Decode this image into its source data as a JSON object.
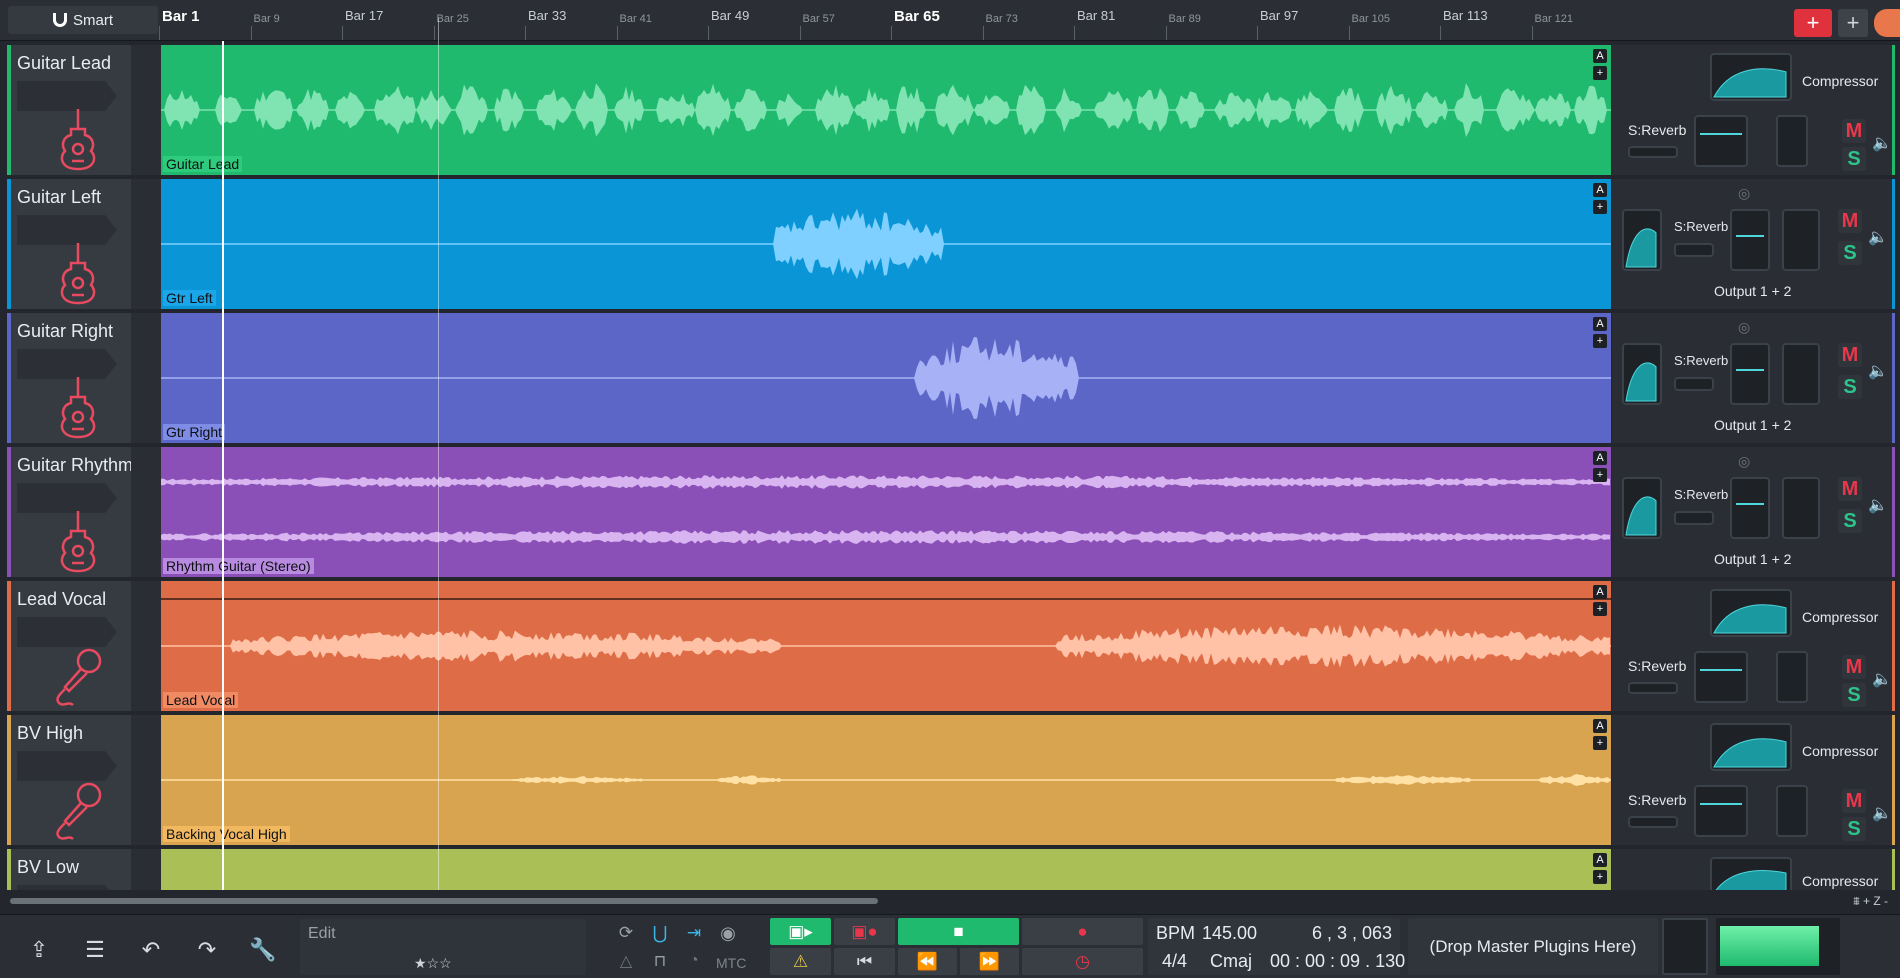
{
  "ruler": {
    "smart_label": "Smart",
    "bars": [
      {
        "label": "Bar 1",
        "kind": "major"
      },
      {
        "label": "Bar 9",
        "kind": "minor"
      },
      {
        "label": "Bar 17",
        "kind": "normal"
      },
      {
        "label": "Bar 25",
        "kind": "minor"
      },
      {
        "label": "Bar 33",
        "kind": "normal"
      },
      {
        "label": "Bar 41",
        "kind": "minor"
      },
      {
        "label": "Bar 49",
        "kind": "normal"
      },
      {
        "label": "Bar 57",
        "kind": "minor"
      },
      {
        "label": "Bar 65",
        "kind": "major"
      },
      {
        "label": "Bar 73",
        "kind": "minor"
      },
      {
        "label": "Bar 81",
        "kind": "normal"
      },
      {
        "label": "Bar 89",
        "kind": "minor"
      },
      {
        "label": "Bar 97",
        "kind": "normal"
      },
      {
        "label": "Bar 105",
        "kind": "minor"
      },
      {
        "label": "Bar 113",
        "kind": "normal"
      },
      {
        "label": "Bar 121",
        "kind": "minor"
      }
    ],
    "add_track_label": "+",
    "add_plus_label": "+"
  },
  "tracks": [
    {
      "name": "Guitar Lead",
      "clip": "Guitar Lead",
      "icon": "guitar-icon",
      "color": "#1fba6e",
      "wave": "#7fe3b2",
      "clip_bg": "#2ecb7d",
      "pattern": "lead",
      "mixer": "full",
      "output": "",
      "comp": "Compressor",
      "reverb": "S:Reverb",
      "m": "M",
      "s": "S"
    },
    {
      "name": "Guitar Left",
      "clip": "Gtr Left",
      "icon": "guitar-icon",
      "color": "#0a96d6",
      "wave": "#7fd0ff",
      "clip_bg": "#1aa6e8",
      "pattern": "burst1",
      "mixer": "compact",
      "output": "Output 1 + 2",
      "comp": "",
      "reverb": "S:Reverb",
      "m": "M",
      "s": "S"
    },
    {
      "name": "Guitar Right",
      "clip": "Gtr Right",
      "icon": "guitar-icon",
      "color": "#5c66c7",
      "wave": "#a6b2f5",
      "clip_bg": "#7f8ce6",
      "pattern": "burst2",
      "mixer": "compact",
      "output": "Output 1 + 2",
      "comp": "",
      "reverb": "S:Reverb",
      "m": "M",
      "s": "S"
    },
    {
      "name": "Guitar Rhythm",
      "clip": "Rhythm Guitar (Stereo)",
      "icon": "guitar-icon",
      "color": "#8b4fb8",
      "wave": "#d8b5f0",
      "clip_bg": "#b98be0",
      "pattern": "stereo",
      "mixer": "compact",
      "output": "Output 1 + 2",
      "comp": "",
      "reverb": "S:Reverb",
      "m": "M",
      "s": "S"
    },
    {
      "name": "Lead Vocal",
      "clip": "Lead Vocal",
      "icon": "microphone-icon",
      "color": "#de6d47",
      "wave": "#ffc2a6",
      "clip_bg": "#f08a63",
      "pattern": "vocal",
      "mixer": "full",
      "output": "",
      "comp": "Compressor",
      "reverb": "S:Reverb",
      "m": "M",
      "s": "S"
    },
    {
      "name": "BV High",
      "clip": "Backing Vocal High",
      "icon": "microphone-icon",
      "color": "#d8a450",
      "wave": "#ffe1a6",
      "clip_bg": "#f2b860",
      "pattern": "bv",
      "mixer": "full",
      "output": "",
      "comp": "Compressor",
      "reverb": "S:Reverb",
      "m": "M",
      "s": "S"
    },
    {
      "name": "BV Low",
      "clip": "",
      "icon": "microphone-icon",
      "color": "#aabf55",
      "wave": "#dbe8a0",
      "clip_bg": "#c2d46a",
      "pattern": "none",
      "mixer": "partial",
      "output": "",
      "comp": "Compressor",
      "reverb": "",
      "m": "",
      "s": ""
    }
  ],
  "lane_badges": {
    "auto": "A",
    "add": "+"
  },
  "zoom_label": "+ Z -",
  "bottom": {
    "edit_label": "Edit",
    "mtc_label": "MTC",
    "bpm_label": "BPM",
    "bpm_value": "145.00",
    "position": "6 , 3 , 063",
    "time_sig": "4/4",
    "key": "Cmaj",
    "time": "00 : 00 : 09 . 130",
    "master_drop": "(Drop Master Plugins Here)",
    "master_level": 0.85
  }
}
